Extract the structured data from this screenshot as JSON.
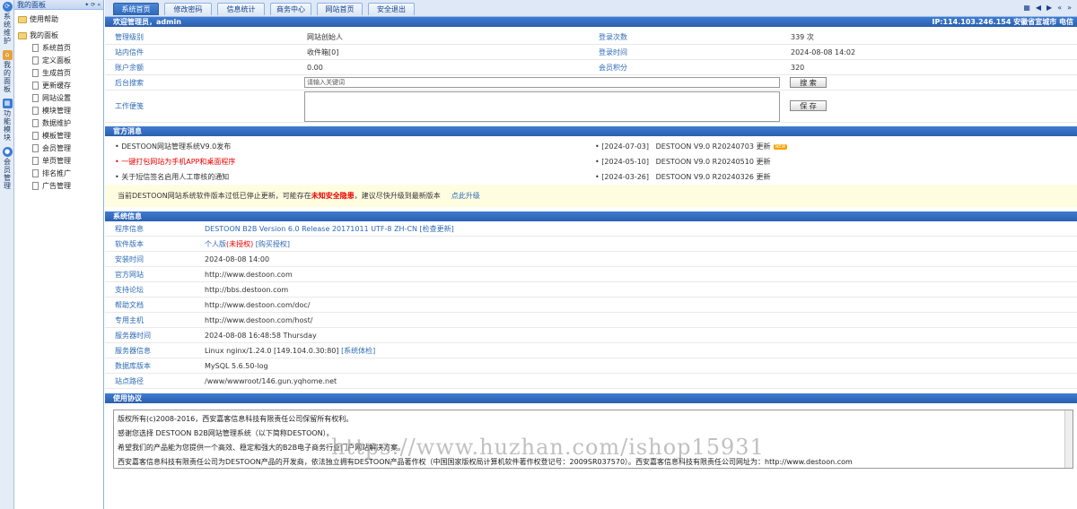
{
  "vertical_tabs": [
    {
      "icon": "refresh-icon",
      "label": "系统维护",
      "color": "#3a7bd5"
    },
    {
      "icon": "home-icon",
      "label": "我的面板",
      "color": "#e6a23c"
    },
    {
      "icon": "module-icon",
      "label": "功能模块",
      "color": "#3a7bd5"
    },
    {
      "icon": "user-icon",
      "label": "会员管理",
      "color": "#3a7bd5"
    }
  ],
  "tree": {
    "title": "我的面板",
    "items": [
      "使用帮助",
      "我的面板",
      "系统首页",
      "定义面板",
      "生成首页",
      "更新缓存",
      "网站设置",
      "模块管理",
      "数据维护",
      "模板管理",
      "会员管理",
      "单页管理",
      "排名推广",
      "广告管理"
    ]
  },
  "top_tabs": [
    "系统首页",
    "修改密码",
    "信息统计",
    "商务中心",
    "网站首页",
    "安全退出"
  ],
  "welcome": {
    "title": "欢迎管理员，admin",
    "ip": "IP:114.103.246.154 安徽省宣城市 电信"
  },
  "account": {
    "role_label": "管理级别",
    "role_value": "网站创始人",
    "login_count_label": "登录次数",
    "login_count_value": "339 次",
    "mail_label": "站内信件",
    "mail_value": "收件箱[0]",
    "login_time_label": "登录时间",
    "login_time_value": "2024-08-08 14:02",
    "balance_label": "账户余额",
    "balance_value": "0.00",
    "points_label": "会员积分",
    "points_value": "320",
    "search_label": "后台搜索",
    "search_placeholder": "请输入关键词",
    "search_button": "搜 索",
    "memo_label": "工作便笺",
    "save_button": "保 存"
  },
  "news": {
    "title": "官方消息",
    "left": [
      {
        "text": "DESTOON网站管理系统V9.0发布",
        "red": false
      },
      {
        "text": "一键打包网站为手机APP和桌面程序",
        "red": true
      },
      {
        "text": "关于短信签名启用人工审核的通知",
        "red": false
      }
    ],
    "right": [
      {
        "text": "[2024-07-03]   DESTOON V9.0 R20240703 更新",
        "badge": "NEW"
      },
      {
        "text": "[2024-05-10]   DESTOON V9.0 R20240510 更新",
        "badge": ""
      },
      {
        "text": "[2024-03-26]   DESTOON V9.0 R20240326 更新",
        "badge": ""
      }
    ]
  },
  "warning": {
    "pre": "当前DESTOON网站系统软件版本过低已停止更新，可能存在",
    "risk": "未知安全隐患",
    "post": "，建议尽快升级到最新版本",
    "link": "点此升级"
  },
  "sysinfo": {
    "title": "系统信息",
    "rows": [
      {
        "label": "程序信息",
        "value": "DESTOON B2B Version 6.0 Release 20171011 UTF-8 ZH-CN [检查更新]",
        "blue": true
      },
      {
        "label": "软件版本",
        "value": "个人版",
        "value_red": "(未授权)",
        "value_extra": " [购买授权]",
        "blue": true
      },
      {
        "label": "安装时间",
        "value": "2024-08-08 14:00"
      },
      {
        "label": "官方网站",
        "value": "http://www.destoon.com"
      },
      {
        "label": "支持论坛",
        "value": "http://bbs.destoon.com"
      },
      {
        "label": "帮助文档",
        "value": "http://www.destoon.com/doc/"
      },
      {
        "label": "专用主机",
        "value": "http://www.destoon.com/host/"
      },
      {
        "label": "服务器时间",
        "value": "2024-08-08 16:48:58 Thursday"
      },
      {
        "label": "服务器信息",
        "value": "Linux nginx/1.24.0 [149.104.0.30:80] ",
        "value_extra": "[系统体检]"
      },
      {
        "label": "数据库版本",
        "value": "MySQL 5.6.50-log"
      },
      {
        "label": "站点路径",
        "value": "/www/wwwroot/146.gun.yqhome.net"
      }
    ]
  },
  "license": {
    "title": "使用协议",
    "lines": [
      "版权所有(c)2008-2016，西安嘉客信息科技有限责任公司保留所有权利。",
      "感谢您选择 DESTOON B2B网站管理系统（以下简称DESTOON）。",
      "希望我们的产品能为您提供一个高效、稳定和强大的B2B电子商务行业门户网站解决方案。",
      "西安嘉客信息科技有限责任公司为DESTOON产品的开发商，依法独立拥有DESTOON产品著作权（中国国家版权局计算机软件著作权登记号：2009SR037570）。西安嘉客信息科技有限责任公司网址为：http://www.destoon.com"
    ]
  },
  "watermark": "https://www.huzhan.com/ishop15931"
}
